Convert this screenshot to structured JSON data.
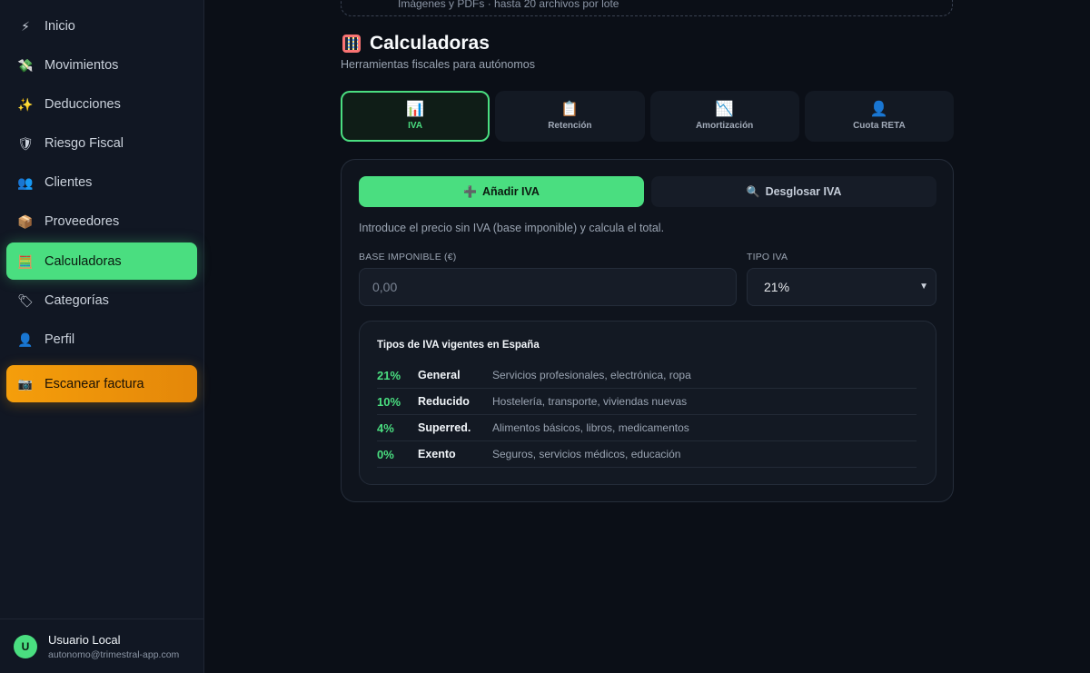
{
  "sidebar": {
    "items": [
      {
        "label": "Inicio",
        "icon": "lightning-icon",
        "glyph": "⚡"
      },
      {
        "label": "Movimientos",
        "icon": "money-wings-icon",
        "glyph": "💸"
      },
      {
        "label": "Deducciones",
        "icon": "sparkles-icon",
        "glyph": "✨"
      },
      {
        "label": "Riesgo Fiscal",
        "icon": "shield-icon",
        "glyph": "🛡"
      },
      {
        "label": "Clientes",
        "icon": "people-icon",
        "glyph": "👥"
      },
      {
        "label": "Proveedores",
        "icon": "package-icon",
        "glyph": "📦"
      },
      {
        "label": "Calculadoras",
        "icon": "abacus-icon",
        "glyph": "🧮"
      },
      {
        "label": "Categorías",
        "icon": "tag-icon",
        "glyph": "🏷"
      },
      {
        "label": "Perfil",
        "icon": "person-icon",
        "glyph": "👤"
      }
    ],
    "active_index": 6,
    "scan_button": {
      "label": "Escanear factura",
      "icon": "camera-icon",
      "glyph": "📷"
    },
    "user": {
      "initial": "U",
      "name": "Usuario Local",
      "email": "autonomo@trimestral-app.com"
    }
  },
  "upload": {
    "hint": "Imágenes y PDFs · hasta 20 archivos por lote"
  },
  "header": {
    "title": "Calculadoras",
    "subtitle": "Herramientas fiscales para autónomos",
    "icon": "abacus-icon"
  },
  "tabs": [
    {
      "label": "IVA",
      "icon": "bar-chart-icon",
      "glyph": "📊",
      "active": true
    },
    {
      "label": "Retención",
      "icon": "clipboard-icon",
      "glyph": "📋",
      "active": false
    },
    {
      "label": "Amortización",
      "icon": "chart-decreasing-icon",
      "glyph": "📉",
      "active": false
    },
    {
      "label": "Cuota RETA",
      "icon": "person-icon",
      "glyph": "👤",
      "active": false
    }
  ],
  "calculator": {
    "mode_add": {
      "label": "Añadir IVA",
      "glyph": "➕"
    },
    "mode_split": {
      "label": "Desglosar IVA",
      "glyph": "🔍"
    },
    "hint": "Introduce el precio sin IVA (base imponible) y calcula el total.",
    "base_label": "BASE IMPONIBLE (€)",
    "base_placeholder": "0,00",
    "iva_label": "TIPO IVA",
    "iva_selected": "21%",
    "rates_title": "Tipos de IVA vigentes en España",
    "rates": [
      {
        "pct": "21%",
        "name": "General",
        "desc": "Servicios profesionales, electrónica, ropa"
      },
      {
        "pct": "10%",
        "name": "Reducido",
        "desc": "Hostelería, transporte, viviendas nuevas"
      },
      {
        "pct": "4%",
        "name": "Superred.",
        "desc": "Alimentos básicos, libros, medicamentos"
      },
      {
        "pct": "0%",
        "name": "Exento",
        "desc": "Seguros, servicios médicos, educación"
      }
    ]
  },
  "colors": {
    "accent": "#4ade80",
    "warning": "#f59e0b",
    "background": "#0b0f17",
    "sidebar": "#111723"
  }
}
